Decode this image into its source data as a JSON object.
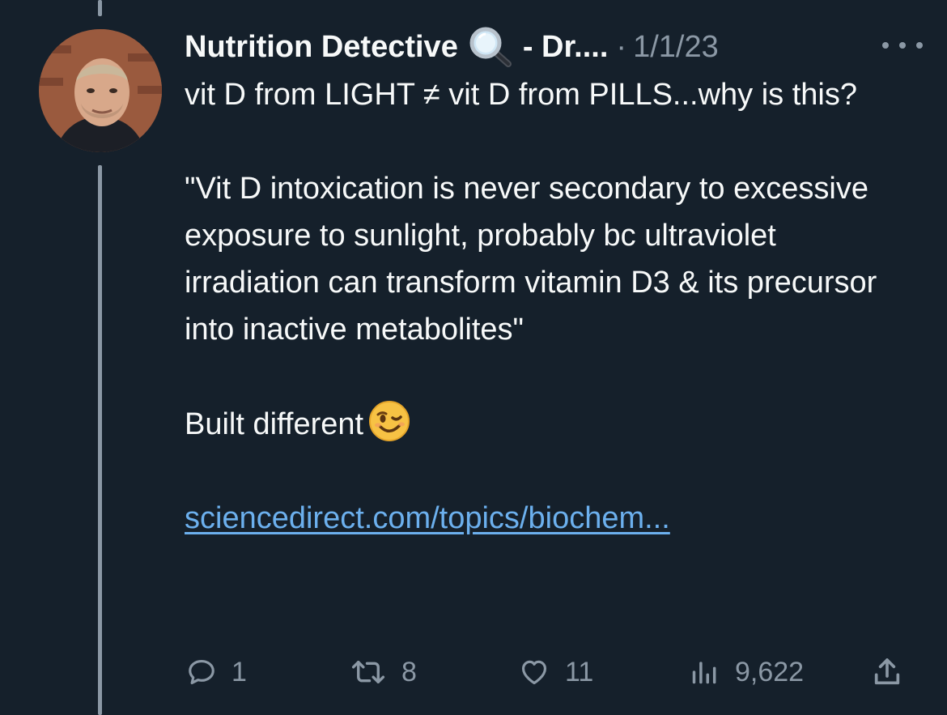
{
  "tweet": {
    "author_name": "Nutrition Detective",
    "author_suffix": "- Dr....",
    "separator": "·",
    "date": "1/1/23",
    "body_line1": "vit D from LIGHT ≠ vit D from PILLS...why is this?",
    "quote": "\"Vit D intoxication is never secondary to excessive exposure to sunlight, probably bc ultraviolet irradiation can transform vitamin D3 & its precursor into inactive metabolites\"",
    "closing": "Built different",
    "link_text": "sciencedirect.com/topics/biochem..."
  },
  "icons": {
    "author_badge": "magnifying-glass-emoji",
    "closing_emoji": "winking-face-emoji",
    "more": "more-horizontal-icon",
    "reply": "reply-icon",
    "retweet": "retweet-icon",
    "like": "heart-icon",
    "views": "views-icon",
    "share": "share-icon"
  },
  "stats": {
    "replies": "1",
    "retweets": "8",
    "likes": "11",
    "views": "9,622"
  },
  "colors": {
    "background": "#15202b",
    "text": "#f7f9f9",
    "muted": "#8b98a5",
    "link": "#6cb0ee"
  }
}
